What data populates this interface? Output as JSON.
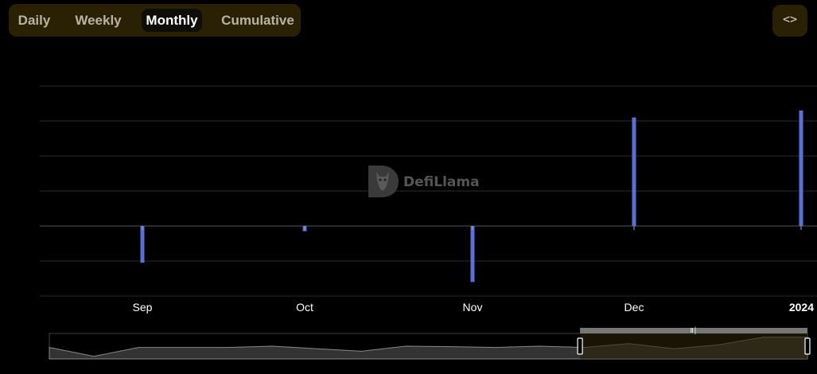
{
  "tabs": [
    {
      "label": "Daily",
      "active": false
    },
    {
      "label": "Weekly",
      "active": false
    },
    {
      "label": "Monthly",
      "active": true
    },
    {
      "label": "Cumulative",
      "active": false
    }
  ],
  "embed_button": {
    "icon": "code-icon",
    "glyph": "<>"
  },
  "watermark": {
    "text": "DefiLlama",
    "icon": "llama-logo"
  },
  "colors": {
    "bar": "#5b6fd6",
    "grid": "#2a2a2a",
    "brush_fill": "#2a2105",
    "area": "#333333"
  },
  "chart_data": {
    "type": "bar",
    "title": "",
    "xlabel": "",
    "ylabel": "",
    "grid": true,
    "x_ticks": [
      "Sep",
      "Oct",
      "Nov",
      "Dec",
      "2024"
    ],
    "categories": [
      "Sep",
      "Oct",
      "Nov",
      "Dec",
      "2024"
    ],
    "values": [
      -1.05,
      -0.15,
      -1.6,
      3.1,
      3.3
    ],
    "ylim": [
      -2,
      4
    ]
  },
  "brush": {
    "selected_from_fraction": 0.7,
    "selected_to_fraction": 1.0,
    "overview_values": [
      0.45,
      0.1,
      0.45,
      0.45,
      0.45,
      0.5,
      0.4,
      0.3,
      0.5,
      0.48,
      0.45,
      0.5,
      0.45,
      0.6,
      0.4,
      0.55,
      0.85,
      0.85
    ]
  }
}
